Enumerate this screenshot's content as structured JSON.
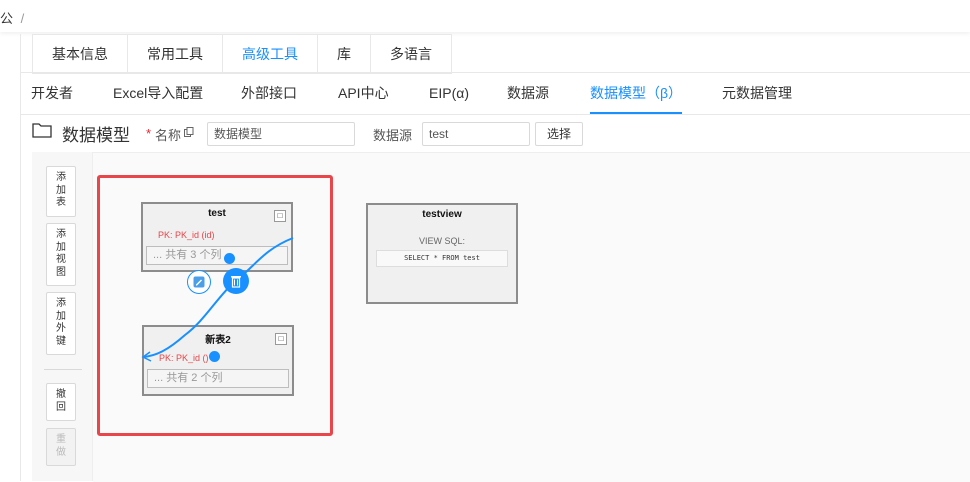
{
  "breadcrumb": {
    "text": "公",
    "sep": "/"
  },
  "tabs_primary": [
    "基本信息",
    "常用工具",
    "高级工具",
    "库",
    "多语言"
  ],
  "tabs_primary_active": "高级工具",
  "tabs_secondary": [
    "开发者",
    "Excel导入配置",
    "外部接口",
    "API中心",
    "EIP(α)",
    "数据源",
    "数据模型（β）",
    "元数据管理"
  ],
  "tabs_secondary_active": "数据模型（β）",
  "form": {
    "title": "数据模型",
    "required_mark": "*",
    "name_label": "名称",
    "name_value": "数据模型",
    "datasource_label": "数据源",
    "datasource_value": "test",
    "select_button": "选择"
  },
  "toolbar": {
    "add_table": "添\n加\n表",
    "add_view": "添\n加\n视\n图",
    "add_fk": "添\n加\n外\n键",
    "undo": "撤\n回",
    "redo": "重\n做"
  },
  "nodes": {
    "test": {
      "title": "test",
      "pk": "PK: PK_id (id)",
      "cols": "... 共有 3 个列"
    },
    "newtable": {
      "title": "新表2",
      "pk": "PK: PK_id ()",
      "cols": "... 共有 2 个列"
    },
    "testview": {
      "title": "testview",
      "view_label": "VIEW SQL:",
      "sql": "SELECT * FROM test"
    }
  },
  "icons": {
    "folder": "folder-icon",
    "copy": "copy-icon",
    "close": "close-icon",
    "edit": "edit-icon",
    "delete": "trash-icon"
  },
  "colors": {
    "accent": "#1890ff",
    "highlight_box": "#e8464a",
    "pk_text": "#e8464a"
  }
}
